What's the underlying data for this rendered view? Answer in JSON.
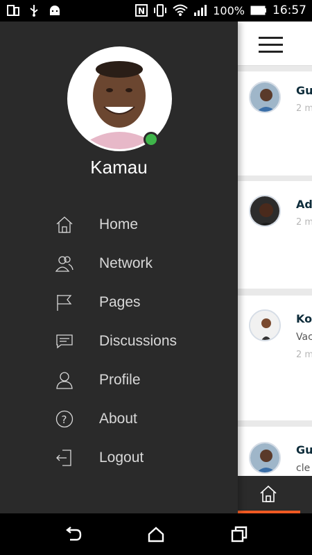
{
  "status_bar": {
    "battery": "100%",
    "time": "16:57"
  },
  "drawer": {
    "user_name": "Kamau",
    "online_status_color": "#3fb54a",
    "menu": [
      {
        "label": "Home",
        "icon": "home-icon"
      },
      {
        "label": "Network",
        "icon": "network-icon"
      },
      {
        "label": "Pages",
        "icon": "flag-icon"
      },
      {
        "label": "Discussions",
        "icon": "discussions-icon"
      },
      {
        "label": "Profile",
        "icon": "profile-icon"
      },
      {
        "label": "About",
        "icon": "help-icon"
      },
      {
        "label": "Logout",
        "icon": "logout-icon"
      }
    ]
  },
  "feed": {
    "items": [
      {
        "name": "Gu",
        "sub": "2 m"
      },
      {
        "name": "Ad",
        "sub": "2 m"
      },
      {
        "name": "Ko",
        "text": "Vac",
        "sub": "2 m"
      },
      {
        "name": "Gu",
        "text": "cle"
      }
    ]
  },
  "colors": {
    "accent": "#f05a22",
    "drawer_bg": "#2a2a2a"
  }
}
